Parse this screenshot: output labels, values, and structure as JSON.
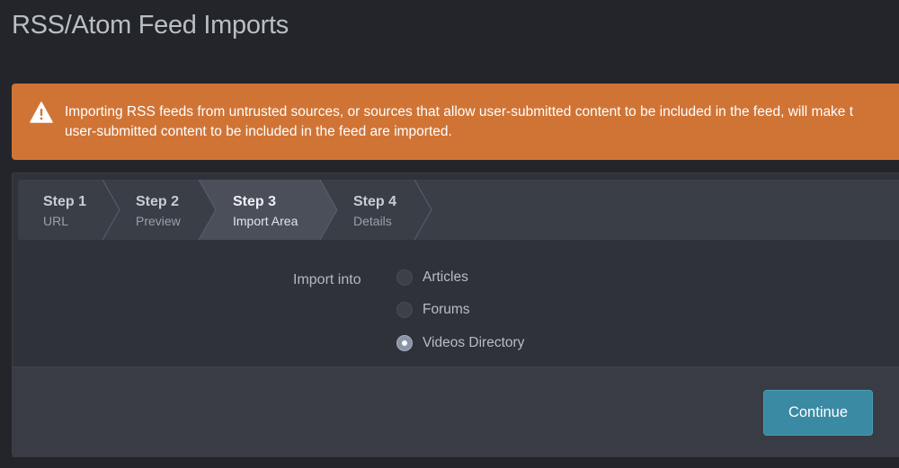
{
  "header": {
    "title": "RSS/Atom Feed Imports"
  },
  "warning": {
    "icon": "warning-triangle-icon",
    "line1": "Importing RSS feeds from untrusted sources, or sources that allow user-submitted content to be included in the feed, will make t",
    "line2": "user-submitted content to be included in the feed are imported.",
    "color": "#d07436"
  },
  "steps": [
    {
      "number": "Step 1",
      "label": "URL"
    },
    {
      "number": "Step 2",
      "label": "Preview"
    },
    {
      "number": "Step 3",
      "label": "Import Area",
      "active": true
    },
    {
      "number": "Step 4",
      "label": "Details"
    }
  ],
  "form": {
    "label": "Import into",
    "options": [
      {
        "label": "Articles",
        "checked": false
      },
      {
        "label": "Forums",
        "checked": false
      },
      {
        "label": "Videos Directory",
        "checked": true
      }
    ]
  },
  "footer": {
    "continue_label": "Continue",
    "accent": "#3a8aa3"
  }
}
